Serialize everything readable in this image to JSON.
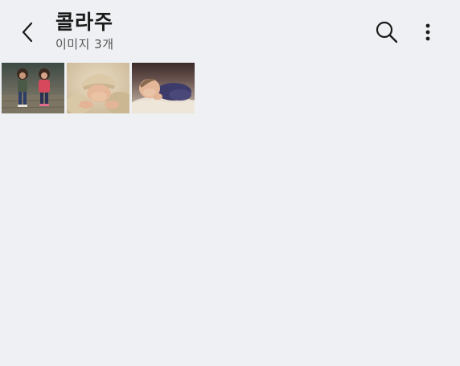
{
  "header": {
    "title": "콜라주",
    "subtitle": "이미지 3개",
    "back_icon": "chevron-left-icon",
    "search_icon": "search-icon",
    "more_icon": "more-vertical-icon"
  },
  "images": [
    {
      "name": "image-two-children-standing"
    },
    {
      "name": "image-baby-in-knit-hat"
    },
    {
      "name": "image-sleeping-baby"
    }
  ],
  "colors": {
    "background": "#eef0f3",
    "text_primary": "#1a1a1a",
    "text_secondary": "#555555"
  }
}
